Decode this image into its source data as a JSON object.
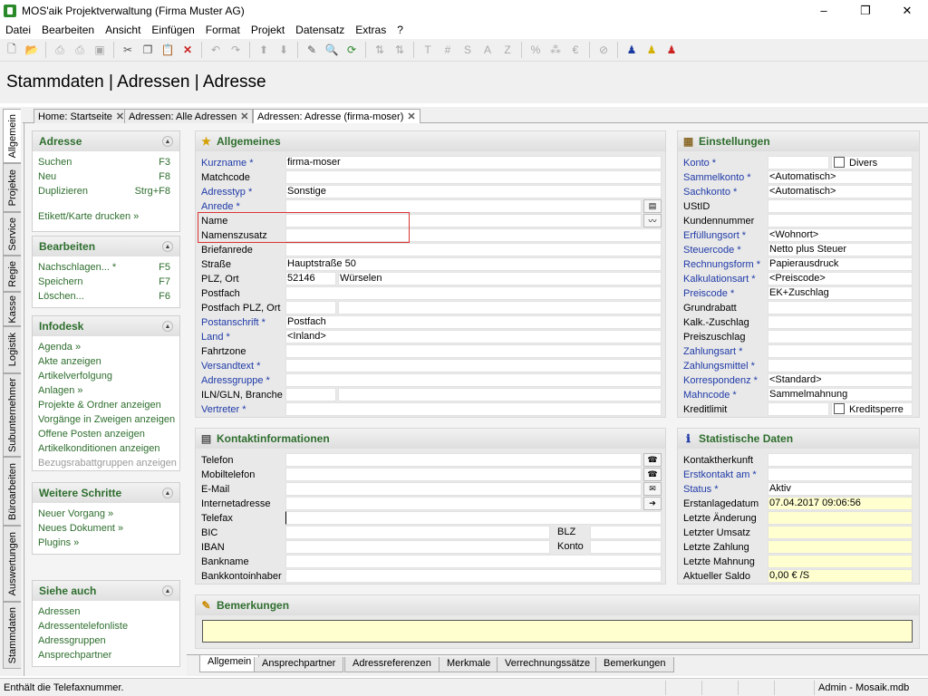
{
  "window": {
    "title": "MOS'aik Projektverwaltung (Firma Muster AG)",
    "minimize": "–",
    "maximize": "❐",
    "close": "✕"
  },
  "menu": [
    "Datei",
    "Bearbeiten",
    "Ansicht",
    "Einfügen",
    "Format",
    "Projekt",
    "Datensatz",
    "Extras",
    "?"
  ],
  "toolbar": {
    "text_tools": [
      "T",
      "#",
      "S",
      "A",
      "Z"
    ]
  },
  "page_title": "Stammdaten | Adressen | Adresse",
  "vertical_tabs": [
    "Allgemein",
    "Projekte",
    "Service",
    "Regie",
    "Kasse",
    "Logistik",
    "Subunternehmer",
    "Büroarbeiten",
    "Auswertungen",
    "Stammdaten"
  ],
  "doc_tabs": [
    "Home: Startseite",
    "Adressen: Alle Adressen",
    "Adressen: Adresse (firma-moser)"
  ],
  "sidebar": {
    "adresse": {
      "title": "Adresse",
      "items": [
        {
          "label": "Suchen",
          "shortcut": "F3"
        },
        {
          "label": "Neu",
          "shortcut": "F8"
        },
        {
          "label": "Duplizieren",
          "shortcut": "Strg+F8"
        },
        {
          "label": "Etikett/Karte drucken »",
          "shortcut": ""
        }
      ]
    },
    "bearbeiten": {
      "title": "Bearbeiten",
      "items": [
        {
          "label": "Nachschlagen... *",
          "shortcut": "F5"
        },
        {
          "label": "Speichern",
          "shortcut": "F7"
        },
        {
          "label": "Löschen...",
          "shortcut": "F6"
        }
      ]
    },
    "infodesk": {
      "title": "Infodesk",
      "items": [
        "Agenda »",
        "Akte anzeigen",
        "Artikelverfolgung",
        "Anlagen »",
        "Projekte & Ordner anzeigen",
        "Vorgänge in Zweigen anzeigen",
        "Offene Posten anzeigen",
        "Artikelkonditionen anzeigen",
        "Bezugsrabattgruppen anzeigen"
      ]
    },
    "weitere": {
      "title": "Weitere Schritte",
      "items": [
        "Neuer Vorgang »",
        "Neues Dokument »",
        "Plugins »"
      ]
    },
    "siehe": {
      "title": "Siehe auch",
      "items": [
        "Adressen",
        "Adressentelefonliste",
        "Adressgruppen",
        "Ansprechpartner"
      ]
    }
  },
  "allgemeines": {
    "title": "Allgemeines",
    "fields": [
      {
        "label": "Kurzname *",
        "value": "firma-moser"
      },
      {
        "label": "Matchcode",
        "value": ""
      },
      {
        "label": "Adresstyp *",
        "value": "Sonstige"
      },
      {
        "label": "Anrede *",
        "value": ""
      },
      {
        "label": "Name",
        "value": ""
      },
      {
        "label": "Namenszusatz",
        "value": ""
      },
      {
        "label": "Briefanrede",
        "value": ""
      },
      {
        "label": "Straße",
        "value": "Hauptstraße 50"
      },
      {
        "label": "PLZ, Ort",
        "value": "52146",
        "value2": "Würselen"
      },
      {
        "label": "Postfach",
        "value": ""
      },
      {
        "label": "Postfach PLZ, Ort",
        "value": "",
        "value2": ""
      },
      {
        "label": "Postanschrift *",
        "value": "Postfach"
      },
      {
        "label": "Land *",
        "value": "<Inland>"
      },
      {
        "label": "Fahrtzone",
        "value": ""
      },
      {
        "label": "Versandtext *",
        "value": ""
      },
      {
        "label": "Adressgruppe *",
        "value": ""
      },
      {
        "label": "ILN/GLN, Branche",
        "value": "",
        "value2": ""
      },
      {
        "label": "Vertreter *",
        "value": ""
      }
    ]
  },
  "einstellungen": {
    "title": "Einstellungen",
    "divers": "Divers",
    "kreditsperre": "Kreditsperre",
    "fields": [
      {
        "label": "Konto *",
        "value": ""
      },
      {
        "label": "Sammelkonto *",
        "value": "<Automatisch>"
      },
      {
        "label": "Sachkonto *",
        "value": "<Automatisch>"
      },
      {
        "label": "UStID",
        "value": ""
      },
      {
        "label": "Kundennummer",
        "value": ""
      },
      {
        "label": "Erfüllungsort *",
        "value": "<Wohnort>"
      },
      {
        "label": "Steuercode *",
        "value": "Netto plus Steuer"
      },
      {
        "label": "Rechnungsform *",
        "value": "Papierausdruck"
      },
      {
        "label": "Kalkulationsart *",
        "value": "<Preiscode>"
      },
      {
        "label": "Preiscode *",
        "value": "EK+Zuschlag"
      },
      {
        "label": "Grundrabatt",
        "value": ""
      },
      {
        "label": "Kalk.-Zuschlag",
        "value": ""
      },
      {
        "label": "Preiszuschlag",
        "value": ""
      },
      {
        "label": "Zahlungsart *",
        "value": ""
      },
      {
        "label": "Zahlungsmittel *",
        "value": ""
      },
      {
        "label": "Korrespondenz *",
        "value": "<Standard>"
      },
      {
        "label": "Mahncode *",
        "value": "Sammelmahnung"
      },
      {
        "label": "Kreditlimit",
        "value": ""
      }
    ]
  },
  "kontakt": {
    "title": "Kontaktinformationen",
    "fields": [
      {
        "label": "Telefon",
        "value": ""
      },
      {
        "label": "Mobiltelefon",
        "value": ""
      },
      {
        "label": "E-Mail",
        "value": ""
      },
      {
        "label": "Internetadresse",
        "value": ""
      },
      {
        "label": "Telefax",
        "value": ""
      },
      {
        "label": "BIC",
        "value": "",
        "label2": "BLZ",
        "value2": ""
      },
      {
        "label": "IBAN",
        "value": "",
        "label2": "Konto",
        "value2": ""
      },
      {
        "label": "Bankname",
        "value": ""
      },
      {
        "label": "Bankkontoinhaber",
        "value": ""
      }
    ]
  },
  "statistik": {
    "title": "Statistische Daten",
    "fields": [
      {
        "label": "Kontaktherkunft",
        "value": ""
      },
      {
        "label": "Erstkontakt am *",
        "value": ""
      },
      {
        "label": "Status *",
        "value": "Aktiv"
      },
      {
        "label": "Erstanlagedatum",
        "value": "07.04.2017 09:06:56"
      },
      {
        "label": "Letzte Änderung",
        "value": ""
      },
      {
        "label": "Letzter Umsatz",
        "value": ""
      },
      {
        "label": "Letzte Zahlung",
        "value": ""
      },
      {
        "label": "Letzte Mahnung",
        "value": ""
      },
      {
        "label": "Aktueller Saldo",
        "value": "0,00 € /S"
      }
    ]
  },
  "bemerkungen": {
    "title": "Bemerkungen",
    "value": ""
  },
  "bottom_tabs": [
    "Allgemein",
    "Ansprechpartner",
    "Adressreferenzen",
    "Merkmale",
    "Verrechnungssätze",
    "Bemerkungen"
  ],
  "status": {
    "message": "Enthält die Telefaxnummer.",
    "user_db": "Admin - Mosaik.mdb"
  }
}
